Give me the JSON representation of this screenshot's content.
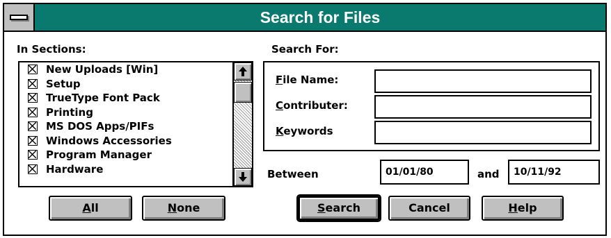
{
  "window": {
    "title": "Search for Files"
  },
  "sections": {
    "label": "In Sections:",
    "items": [
      {
        "label": "New Uploads [Win]",
        "checked": true
      },
      {
        "label": "Setup",
        "checked": true
      },
      {
        "label": "TrueType Font Pack",
        "checked": true
      },
      {
        "label": "Printing",
        "checked": true
      },
      {
        "label": "MS DOS Apps/PIFs",
        "checked": true
      },
      {
        "label": "Windows Accessories",
        "checked": true
      },
      {
        "label": "Program Manager",
        "checked": true
      },
      {
        "label": "Hardware",
        "checked": true
      }
    ],
    "scroll_up_icon": "arrow-up-icon",
    "scroll_down_icon": "arrow-down-icon"
  },
  "search_for": {
    "label": "Search For:",
    "file_name": {
      "mnemonic": "F",
      "rest": "ile Name:",
      "value": ""
    },
    "contributer": {
      "mnemonic": "C",
      "rest": "ontributer:",
      "value": ""
    },
    "keywords": {
      "mnemonic": "K",
      "rest": "eywords",
      "value": ""
    }
  },
  "date_range": {
    "between_label": "Between",
    "from": "01/01/80",
    "and_label": "and",
    "to": "10/11/92"
  },
  "buttons": {
    "all": {
      "mnemonic": "A",
      "rest": "ll"
    },
    "none": {
      "mnemonic": "N",
      "rest": "one"
    },
    "search": {
      "mnemonic": "S",
      "rest": "earch"
    },
    "cancel": {
      "label": "Cancel"
    },
    "help": {
      "mnemonic": "H",
      "rest": "elp"
    }
  },
  "colors": {
    "titlebar": "#0b7a6e",
    "face": "#c0c0c0"
  }
}
